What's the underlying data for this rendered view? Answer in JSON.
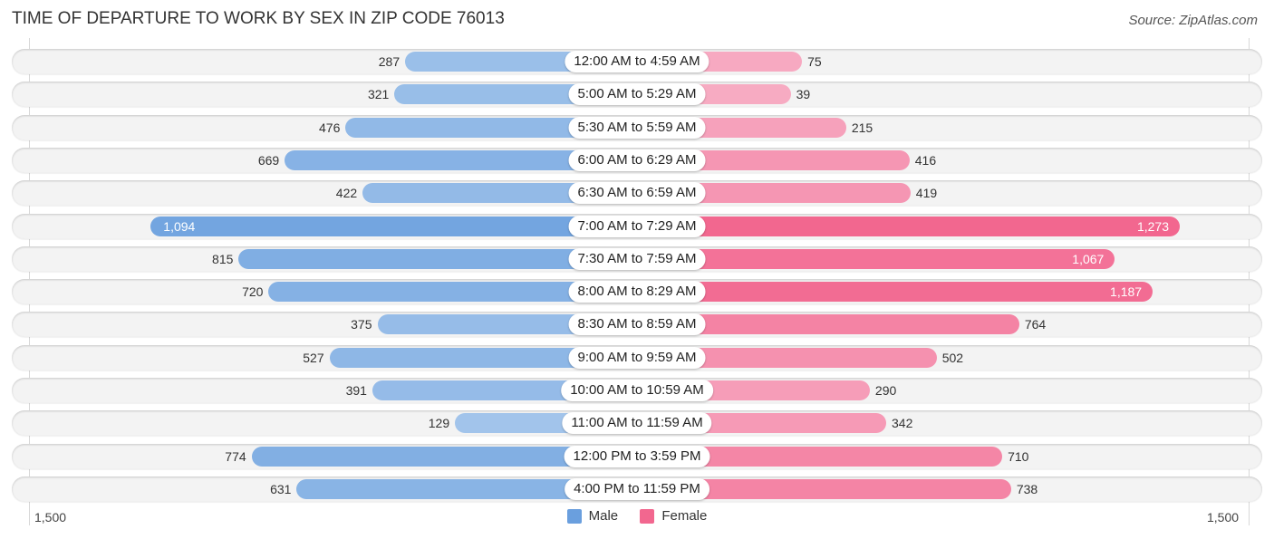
{
  "header": {
    "title": "TIME OF DEPARTURE TO WORK BY SEX IN ZIP CODE 76013",
    "source": "Source: ZipAtlas.com"
  },
  "colors": {
    "male_strong": "#6a9fde",
    "male_light": "#a8c8ec",
    "female_strong": "#f2678f",
    "female_light": "#f7adc4"
  },
  "chart_data": {
    "type": "bar",
    "orientation": "horizontal-diverging",
    "title": "TIME OF DEPARTURE TO WORK BY SEX IN ZIP CODE 76013",
    "categories": [
      "12:00 AM to 4:59 AM",
      "5:00 AM to 5:29 AM",
      "5:30 AM to 5:59 AM",
      "6:00 AM to 6:29 AM",
      "6:30 AM to 6:59 AM",
      "7:00 AM to 7:29 AM",
      "7:30 AM to 7:59 AM",
      "8:00 AM to 8:29 AM",
      "8:30 AM to 8:59 AM",
      "9:00 AM to 9:59 AM",
      "10:00 AM to 10:59 AM",
      "11:00 AM to 11:59 AM",
      "12:00 PM to 3:59 PM",
      "4:00 PM to 11:59 PM"
    ],
    "series": [
      {
        "name": "Male",
        "values": [
          287,
          321,
          476,
          669,
          422,
          1094,
          815,
          720,
          375,
          527,
          391,
          129,
          774,
          631
        ]
      },
      {
        "name": "Female",
        "values": [
          75,
          39,
          215,
          416,
          419,
          1273,
          1067,
          1187,
          764,
          502,
          290,
          342,
          710,
          738
        ]
      }
    ],
    "value_labels": {
      "Male": [
        "287",
        "321",
        "476",
        "669",
        "422",
        "1,094",
        "815",
        "720",
        "375",
        "527",
        "391",
        "129",
        "774",
        "631"
      ],
      "Female": [
        "75",
        "39",
        "215",
        "416",
        "419",
        "1,273",
        "1,067",
        "1,187",
        "764",
        "502",
        "290",
        "342",
        "710",
        "738"
      ]
    },
    "axis": {
      "min_label": "1,500",
      "max_label": "1,500",
      "range": [
        0,
        1500
      ]
    },
    "legend": {
      "position": "bottom-center",
      "entries": [
        "Male",
        "Female"
      ]
    },
    "grid": false
  }
}
